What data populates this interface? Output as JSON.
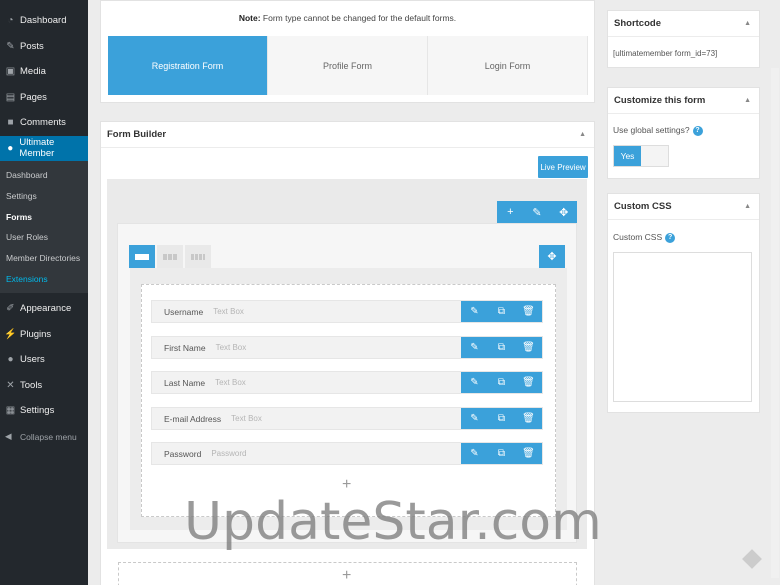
{
  "sidebar": {
    "menu_top": [
      {
        "label": "Dashboard",
        "icon": "dashboard-icon"
      },
      {
        "label": "Posts",
        "icon": "pin-icon"
      },
      {
        "label": "Media",
        "icon": "media-icon"
      },
      {
        "label": "Pages",
        "icon": "pages-icon"
      },
      {
        "label": "Comments",
        "icon": "comments-icon"
      },
      {
        "label": "Ultimate Member",
        "icon": "user-icon"
      }
    ],
    "submenu": [
      "Dashboard",
      "Settings",
      "Forms",
      "User Roles",
      "Member Directories",
      "Extensions"
    ],
    "menu_bottom": [
      {
        "label": "Appearance",
        "icon": "brush-icon"
      },
      {
        "label": "Plugins",
        "icon": "plug-icon"
      },
      {
        "label": "Users",
        "icon": "users-icon"
      },
      {
        "label": "Tools",
        "icon": "wrench-icon"
      },
      {
        "label": "Settings",
        "icon": "settings-icon"
      }
    ],
    "collapse": "Collapse menu"
  },
  "form_type": {
    "note_label": "Note:",
    "note_text": "Form type cannot be changed for the default forms.",
    "tabs": [
      "Registration Form",
      "Profile Form",
      "Login Form"
    ],
    "active_tab": "Registration Form"
  },
  "builder": {
    "title": "Form Builder",
    "live_preview": "Live Preview",
    "fields": [
      {
        "label": "Username",
        "type": "Text Box"
      },
      {
        "label": "First Name",
        "type": "Text Box"
      },
      {
        "label": "Last Name",
        "type": "Text Box"
      },
      {
        "label": "E-mail Address",
        "type": "Text Box"
      },
      {
        "label": "Password",
        "type": "Password"
      }
    ]
  },
  "shortcode": {
    "title": "Shortcode",
    "value": "[ultimatemember form_id=73]"
  },
  "customize": {
    "title": "Customize this form",
    "question": "Use global settings?",
    "toggle_value": "Yes"
  },
  "custom_css": {
    "title": "Custom CSS",
    "label": "Custom CSS"
  },
  "watermark": "UpdateStar.com",
  "colors": {
    "accent": "#3ba1da",
    "sidebar_bg": "#23282d",
    "sidebar_active": "#0073aa"
  }
}
